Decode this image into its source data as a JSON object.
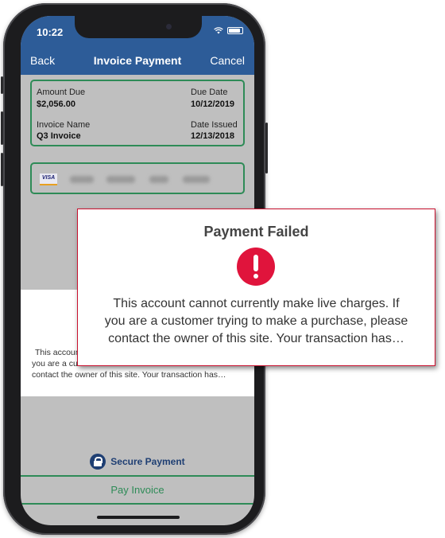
{
  "status_bar": {
    "time": "10:22",
    "wifi_icon": "wifi-icon",
    "battery_icon": "battery-icon"
  },
  "nav": {
    "back": "Back",
    "title": "Invoice Payment",
    "cancel": "Cancel"
  },
  "invoice": {
    "amount_due_label": "Amount Due",
    "amount_due_value": "$2,056.00",
    "due_date_label": "Due Date",
    "due_date_value": "10/12/2019",
    "invoice_name_label": "Invoice Name",
    "invoice_name_value": "Q3 Invoice",
    "date_issued_label": "Date Issued",
    "date_issued_value": "12/13/2018"
  },
  "card": {
    "brand": "VISA"
  },
  "sheet": {
    "lines": [
      "This accoun",
      "you are a cus",
      "contact the owner of this site. Your transaction has…"
    ]
  },
  "secure": {
    "label": "Secure Payment",
    "icon": "lock-icon"
  },
  "pay_button": {
    "label": "Pay Invoice"
  },
  "callout": {
    "title": "Payment Failed",
    "icon": "alert-icon",
    "lines": [
      "This account cannot currently make live charges. If",
      "you are a customer trying to make a purchase, please",
      "contact the owner of this site. Your transaction has…"
    ]
  },
  "colors": {
    "nav_blue": "#2d5c98",
    "accent_green": "#2e8b57",
    "alert_red": "#e0143c",
    "secure_navy": "#1f3f73"
  }
}
